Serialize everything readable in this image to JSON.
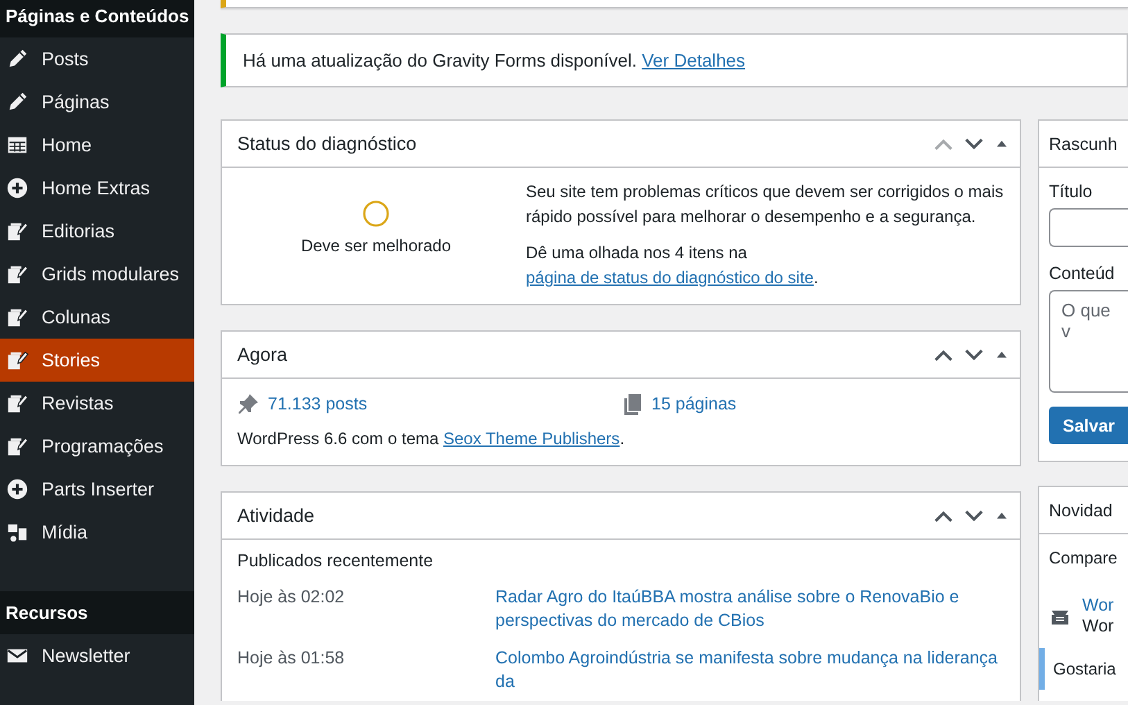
{
  "sidebar": {
    "sections": [
      {
        "title": "Páginas e Conteúdos",
        "items": [
          {
            "label": "Posts",
            "kind": "pencil",
            "selected": false
          },
          {
            "label": "Páginas",
            "kind": "pencil",
            "selected": false
          },
          {
            "label": "Home",
            "kind": "table",
            "selected": false
          },
          {
            "label": "Home Extras",
            "kind": "plus",
            "selected": false
          },
          {
            "label": "Editorias",
            "kind": "note",
            "selected": false
          },
          {
            "label": "Grids modulares",
            "kind": "note",
            "selected": false
          },
          {
            "label": "Colunas",
            "kind": "note",
            "selected": false
          },
          {
            "label": "Stories",
            "kind": "note",
            "selected": true
          },
          {
            "label": "Revistas",
            "kind": "note",
            "selected": false
          },
          {
            "label": "Programações",
            "kind": "note",
            "selected": false
          },
          {
            "label": "Parts Inserter",
            "kind": "plus",
            "selected": false
          },
          {
            "label": "Mídia",
            "kind": "media",
            "selected": false
          }
        ]
      },
      {
        "title": "Recursos",
        "items": [
          {
            "label": "Newsletter",
            "kind": "mail",
            "selected": false
          }
        ]
      }
    ]
  },
  "notice": {
    "text": "Há uma atualização do Gravity Forms disponível.",
    "link": "Ver Detalhes"
  },
  "health": {
    "title": "Status do diagnóstico",
    "up_disabled": true,
    "status": "Deve ser melhorado",
    "message": "Seu site tem problemas críticos que devem ser corrigidos o mais rápido possível para melhorar o desempenho e a segurança.",
    "hint": "Dê uma olhada nos 4 itens na",
    "hint_link": "página de status do diagnóstico do site",
    "hint_end": "."
  },
  "glance": {
    "title": "Agora",
    "up_disabled": false,
    "posts": "71.133 posts",
    "pages": "15 páginas",
    "version": "WordPress 6.6 com o tema",
    "theme": "Seox Theme Publishers",
    "version_end": "."
  },
  "activity": {
    "title": "Atividade",
    "up_disabled": false,
    "subtitle": "Publicados recentemente",
    "rows": [
      {
        "time": "Hoje às 02:02",
        "title": "Radar Agro do ItaúBBA mostra análise sobre o RenovaBio e perspectivas do mercado de CBios"
      },
      {
        "time": "Hoje às 01:58",
        "title": "Colombo Agroindústria se manifesta sobre mudança na liderança da"
      }
    ]
  },
  "draft": {
    "title": "Rascunh",
    "title_label": "Título",
    "content_label": "Conteúd",
    "placeholder": "O que v",
    "button": "Salvar"
  },
  "news": {
    "title": "Novidad",
    "intro": "Compare",
    "item_link": "Wor",
    "item_source": "Wor",
    "footer": "Gostaria"
  }
}
